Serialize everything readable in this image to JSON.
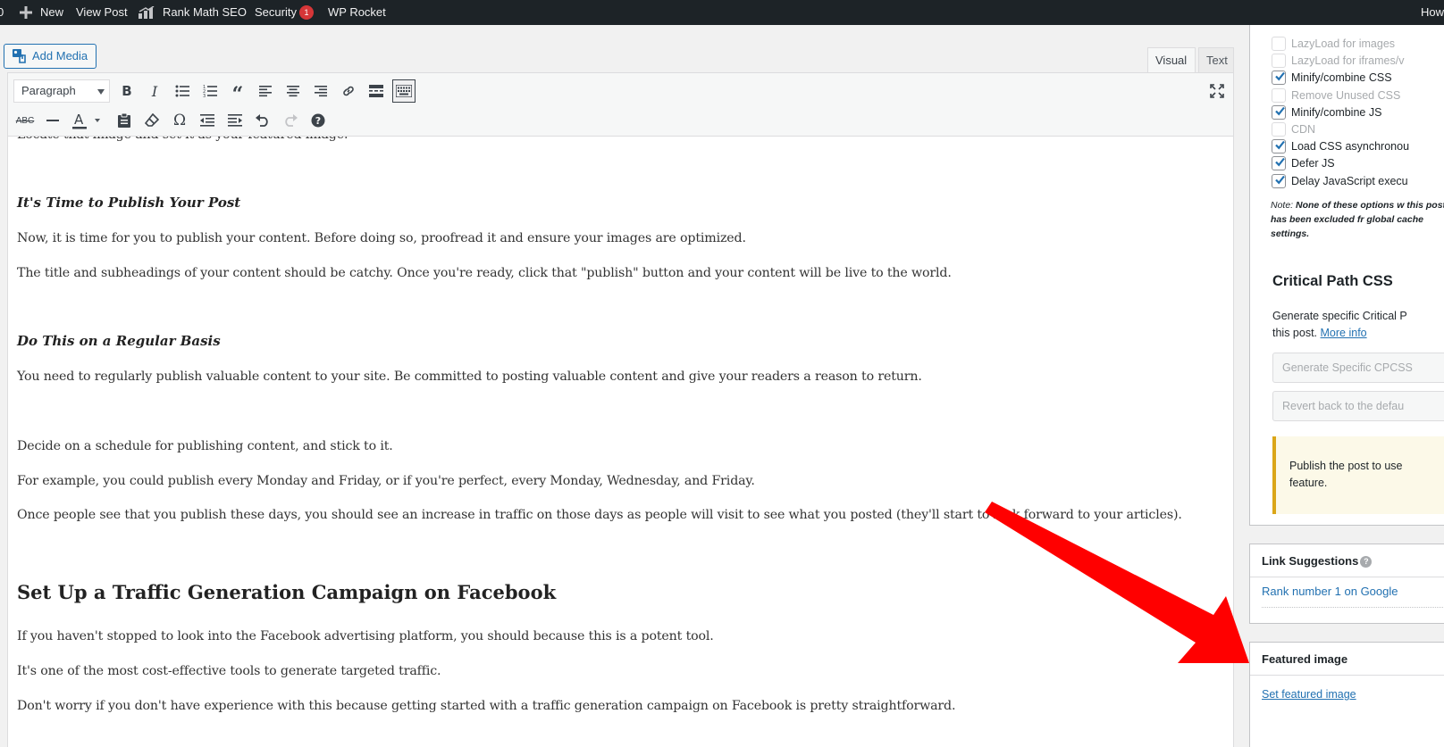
{
  "adminbar": {
    "edge_text": "0",
    "new_label": "New",
    "view_post_label": "View Post",
    "rank_math_label": "Rank Math SEO",
    "security_label": "Security",
    "security_count": "1",
    "wp_rocket_label": "WP Rocket",
    "howdy_label": "How"
  },
  "editor": {
    "add_media_label": "Add Media",
    "tabs": {
      "visual": "Visual",
      "text": "Text"
    },
    "format_select_value": "Paragraph",
    "content": {
      "cut_line": "Locate that image and set it as your featured image.",
      "h_publish": "It's Time to Publish Your Post",
      "p1": "Now, it is time for you to publish your content. Before doing so, proofread it and ensure your images are optimized.",
      "p2": "The title and subheadings of your content should be catchy. Once you're ready, click that \"publish\" button and your content will be live to the world.",
      "h_regular": "Do This on a Regular Basis",
      "p3": "You need to regularly publish valuable content to your site. Be committed to posting valuable content and give your readers a reason to return.",
      "p4": "Decide on a schedule for publishing content, and stick to it.",
      "p5": "For example, you could publish every Monday and Friday, or if you're perfect, every Monday, Wednesday, and Friday.",
      "p6": "Once people see that you publish these days, you should see an increase in traffic on those days as people will visit to see what you posted (they'll start to look forward to your articles).",
      "h2_facebook": "Set Up a Traffic Generation Campaign on Facebook",
      "p7": "If you haven't stopped to look into the Facebook advertising platform, you should because this is a potent tool.",
      "p8": "It's one of the most cost-effective tools to generate targeted traffic.",
      "p9": "Don't worry if you don't have experience with this because getting started with a traffic generation campaign on Facebook is pretty straightforward."
    }
  },
  "sidebar": {
    "rocket_options": [
      {
        "label": "LazyLoad for images",
        "checked": false,
        "disabled": true
      },
      {
        "label": "LazyLoad for iframes/v",
        "checked": false,
        "disabled": true
      },
      {
        "label": "Minify/combine CSS",
        "checked": true,
        "disabled": false
      },
      {
        "label": "Remove Unused CSS",
        "checked": false,
        "disabled": true
      },
      {
        "label": "Minify/combine JS",
        "checked": true,
        "disabled": false
      },
      {
        "label": "CDN",
        "checked": false,
        "disabled": true
      },
      {
        "label": "Load CSS asynchronou",
        "checked": true,
        "disabled": false
      },
      {
        "label": "Defer JS",
        "checked": true,
        "disabled": false
      },
      {
        "label": "Delay JavaScript execu",
        "checked": true,
        "disabled": false
      }
    ],
    "note_prefix": "Note:",
    "note_text": " None of these options w this post has been excluded fr global cache settings.",
    "cpcss_title": "Critical Path CSS",
    "cpcss_desc_1": "Generate specific Critical P",
    "cpcss_desc_2": "this post.",
    "cpcss_more_info": "More info",
    "cpcss_generate_btn": "Generate Specific CPCSS",
    "cpcss_revert_btn": "Revert back to the defau",
    "cpcss_notice_1": "Publish the post to use",
    "cpcss_notice_2": "feature.",
    "link_suggestions_title": "Link Suggestions",
    "link_suggestion_item": "Rank number 1 on Google",
    "featured_image_title": "Featured image",
    "set_featured_image_link": "Set featured image"
  },
  "colors": {
    "adminbar_bg": "#1d2327",
    "link": "#2271b1",
    "notice_border": "#dba617",
    "annotation_arrow": "#ff0000"
  }
}
